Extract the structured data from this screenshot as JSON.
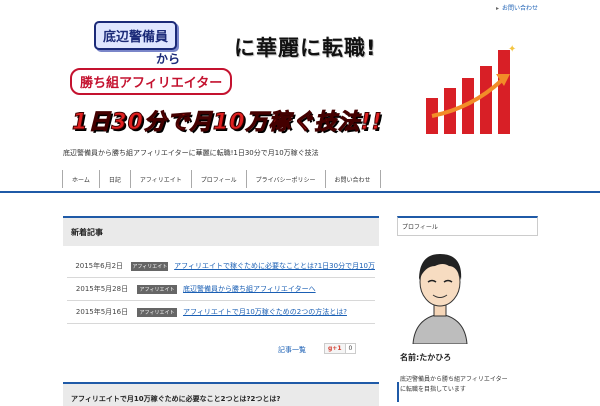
{
  "topbar": {
    "link": "お問い合わせ"
  },
  "banner": {
    "line1": "底辺警備員",
    "line2": "から",
    "line3": "勝ち組アフィリエイター",
    "line4": "に華麗に転職!",
    "line5": "1日30分で月10万稼ぐ技法!!"
  },
  "tagline": "底辺警備員から勝ち組アフィリエイターに華麗に転職!1日30分で月10万稼ぐ技法",
  "nav": {
    "items": [
      {
        "label": "ホーム"
      },
      {
        "label": "日記"
      },
      {
        "label": "アフィリエイト"
      },
      {
        "label": "プロフィール"
      },
      {
        "label": "プライバシーポリシー"
      },
      {
        "label": "お問い合わせ"
      }
    ]
  },
  "main": {
    "section_title": "新着記事",
    "posts": [
      {
        "date": "2015年6月2日",
        "category": "アフィリエイト",
        "title": "アフィリエイトで稼ぐために必要なこととは?1日30分で月10万"
      },
      {
        "date": "2015年5月28日",
        "category": "アフィリエイト",
        "title": "底辺警備員から勝ち組アフィリエイターへ"
      },
      {
        "date": "2015年5月16日",
        "category": "アフィリエイト",
        "title": "アフィリエイトで月10万稼ぐための2つの方法とは?"
      }
    ],
    "more_link": "記事一覧",
    "gplus": {
      "label": "g+1",
      "count": "0"
    },
    "section2_title": "アフィリエイトで月10万稼ぐために必要なこと2つとは?2つとは?"
  },
  "sidebar": {
    "head": "プロフィール",
    "name": "名前:たかひろ",
    "bio_lines": [
      "底辺警備員から勝ち組アフィリエイター",
      "に転職を目指しています"
    ]
  },
  "colors": {
    "accent": "#1f5aa7",
    "link": "#1a5fb4",
    "banner_red": "#e02020"
  }
}
